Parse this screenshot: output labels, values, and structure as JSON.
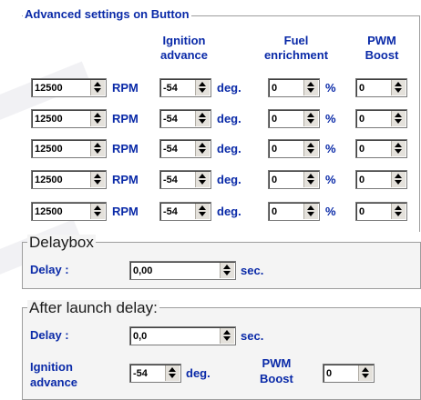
{
  "main": {
    "title": "Advanced settings on Button",
    "headers": {
      "ign_1": "Ignition",
      "ign_2": "advance",
      "fuel_1": "Fuel",
      "fuel_2": "enrichment",
      "pwm_1": "PWM",
      "pwm_2": "Boost"
    },
    "units": {
      "rpm": "RPM",
      "deg": "deg.",
      "pct": "%"
    },
    "rows": [
      {
        "rpm": "12500",
        "ign": "-54",
        "fuel": "0",
        "pwm": "0"
      },
      {
        "rpm": "12500",
        "ign": "-54",
        "fuel": "0",
        "pwm": "0"
      },
      {
        "rpm": "12500",
        "ign": "-54",
        "fuel": "0",
        "pwm": "0"
      },
      {
        "rpm": "12500",
        "ign": "-54",
        "fuel": "0",
        "pwm": "0"
      },
      {
        "rpm": "12500",
        "ign": "-54",
        "fuel": "0",
        "pwm": "0"
      }
    ]
  },
  "delaybox": {
    "title": "Delaybox",
    "delay_label": "Delay :",
    "delay_value": "0,00",
    "unit": "sec."
  },
  "after_launch": {
    "title": "After launch delay:",
    "delay_label": "Delay :",
    "delay_value": "0,0",
    "delay_unit": "sec.",
    "ign_label_1": "Ignition",
    "ign_label_2": "advance",
    "ign_value": "-54",
    "ign_unit": "deg.",
    "pwm_label_1": "PWM",
    "pwm_label_2": "Boost",
    "pwm_value": "0"
  },
  "colors": {
    "label_text": "#0a2aa8",
    "background": "#ffffff",
    "spin_button": "#e4e1db"
  }
}
